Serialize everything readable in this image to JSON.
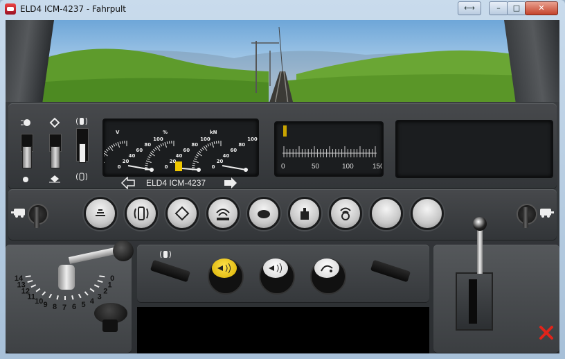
{
  "window": {
    "title": "ELD4 ICM-4237 - Fahrpult",
    "buttons": {
      "resize": "⟷",
      "minimize": "–",
      "maximize": "□",
      "close": "✕"
    }
  },
  "instruments": {
    "gauges": [
      {
        "unit": "V",
        "ticks": [
          "0",
          "20",
          "40",
          "60",
          "80",
          "100"
        ],
        "value_percent": 0
      },
      {
        "unit": "%",
        "ticks": [
          "0",
          "20",
          "40",
          "60",
          "80",
          "100"
        ],
        "value_percent": 8
      },
      {
        "unit": "kN",
        "ticks": [
          "0",
          "20",
          "40",
          "60",
          "80",
          "100"
        ],
        "value_percent": 0
      }
    ],
    "speed_scale": {
      "ticks": [
        "0",
        "50",
        "100",
        "150"
      ],
      "value": 0
    }
  },
  "vehicle_selector": {
    "name": "ELD4 ICM-4237"
  },
  "throttle": {
    "notches": [
      "14",
      "13",
      "12",
      "11",
      "10",
      "9",
      "8",
      "7",
      "6",
      "5",
      "4",
      "3",
      "2",
      "1",
      "0"
    ],
    "position": 0
  },
  "function_buttons": [
    "headlight-icon",
    "coupling-icon",
    "pantograph-icon",
    "sound-icon",
    "slow-mode-icon",
    "weight-icon",
    "horn-signal-icon",
    "blank",
    "blank"
  ],
  "colors": {
    "accent_yellow": "#f0c800",
    "close_red": "#e0241a"
  }
}
